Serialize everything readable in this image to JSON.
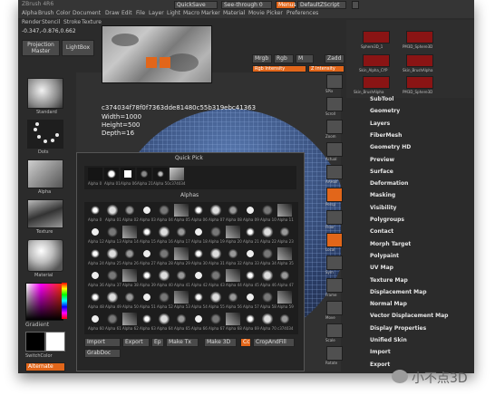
{
  "colors": {
    "accent": "#e2661a",
    "panel": "#2b2b2b",
    "menu_text": "#e6e6e6"
  },
  "top_bar": {
    "app_title": "ZBrush 4R6",
    "quicksave": "QuickSave",
    "see_through": "See-through 0",
    "menus_label": "Menus",
    "script_label": "DefaultZScript"
  },
  "menubar": [
    "Alpha",
    "Brush",
    "Color",
    "Document",
    "Draw",
    "Edit",
    "File",
    "Layer",
    "Light",
    "Macro",
    "Marker",
    "Material",
    "Movie",
    "Picker",
    "Preferences"
  ],
  "menubar2": [
    "Render",
    "Stencil",
    "Stroke",
    "Texture"
  ],
  "coords": "-0.347,-0.876,0.662",
  "projection_master": "Projection Master",
  "lightbox": "LightBox",
  "toolbar": {
    "mrgb": "Mrgb",
    "rgb": "Rgb",
    "m": "M",
    "zadd": "Zadd",
    "rgb_intensity": "Rgb Intensity",
    "z_intensity": "Z Intensity"
  },
  "texture_info": {
    "hash": "c374034f78f0f7363dde81480c55b319ebc41363",
    "width": "Width=1000",
    "height": "Height=500",
    "depth": "Depth=16"
  },
  "left_panel": {
    "labels": [
      "Standard",
      "Dots",
      "Alpha",
      "Texture",
      "Material",
      "Gradient",
      "SwitchColor",
      "Alternate"
    ]
  },
  "subtools": [
    "Sphere3D_1",
    "PM3D_Sphere3D",
    "Skin_Alpha_CYP",
    "Skin_BrushAlpha",
    "Skin_BrushAlpha",
    "PM3D_Sphere3D"
  ],
  "right_strip": [
    "SPix",
    "Scroll",
    "Zoom",
    "Actual",
    "AAHalf",
    "Persp",
    "Floor",
    "Local",
    "Sym",
    "Frame",
    "Move",
    "Scale",
    "Rotate"
  ],
  "quick_pick": {
    "title": "Quick Pick",
    "items": [
      "Alpha 0",
      "Alpha 01",
      "Alpha 06",
      "Alpha 21",
      "Alpha 50",
      "c374034"
    ]
  },
  "alphas": {
    "title": "Alphas",
    "rows": [
      [
        "Alpha 0",
        "Alpha 01",
        "Alpha 02",
        "Alpha 03",
        "Alpha 04",
        "Alpha 05",
        "Alpha 06",
        "Alpha 07",
        "Alpha 08",
        "Alpha 09",
        "Alpha 10",
        "Alpha 11"
      ],
      [
        "Alpha 12",
        "Alpha 13",
        "Alpha 14",
        "Alpha 15",
        "Alpha 16",
        "Alpha 17",
        "Alpha 18",
        "Alpha 19",
        "Alpha 20",
        "Alpha 21",
        "Alpha 22",
        "Alpha 23"
      ],
      [
        "Alpha 24",
        "Alpha 25",
        "Alpha 26",
        "Alpha 27",
        "Alpha 28",
        "Alpha 29",
        "Alpha 30",
        "Alpha 31",
        "Alpha 32",
        "Alpha 33",
        "Alpha 34",
        "Alpha 35"
      ],
      [
        "Alpha 36",
        "Alpha 37",
        "Alpha 38",
        "Alpha 39",
        "Alpha 40",
        "Alpha 41",
        "Alpha 42",
        "Alpha 43",
        "Alpha 44",
        "Alpha 45",
        "Alpha 46",
        "Alpha 47"
      ],
      [
        "Alpha 48",
        "Alpha 49",
        "Alpha 50",
        "Alpha 51",
        "Alpha 52",
        "Alpha 53",
        "Alpha 54",
        "Alpha 55",
        "Alpha 56",
        "Alpha 57",
        "Alpha 58",
        "Alpha 59"
      ],
      [
        "Alpha 60",
        "Alpha 61",
        "Alpha 62",
        "Alpha 63",
        "Alpha 64",
        "Alpha 65",
        "Alpha 66",
        "Alpha 67",
        "Alpha 68",
        "Alpha 69",
        "Alpha 70",
        "c374034"
      ]
    ]
  },
  "bottom_buttons": {
    "import": "Import",
    "export": "Export",
    "ep": "Ep",
    "make_tx": "Make Tx",
    "make_3d": "Make 3D",
    "cc": "Cc",
    "crop_and_fill": "CropAndFill",
    "grabdoc": "GrabDoc"
  },
  "tool_menu": [
    "SubTool",
    "Geometry",
    "Layers",
    "FiberMesh",
    "Geometry HD",
    "Preview",
    "Surface",
    "Deformation",
    "Masking",
    "Visibility",
    "Polygroups",
    "Contact",
    "Morph Target",
    "Polypaint",
    "UV Map",
    "Texture Map",
    "Displacement Map",
    "Normal Map",
    "Vector Displacement Map",
    "Display Properties",
    "Unified Skin",
    "Import",
    "Export"
  ],
  "watermark": "小不点3D"
}
